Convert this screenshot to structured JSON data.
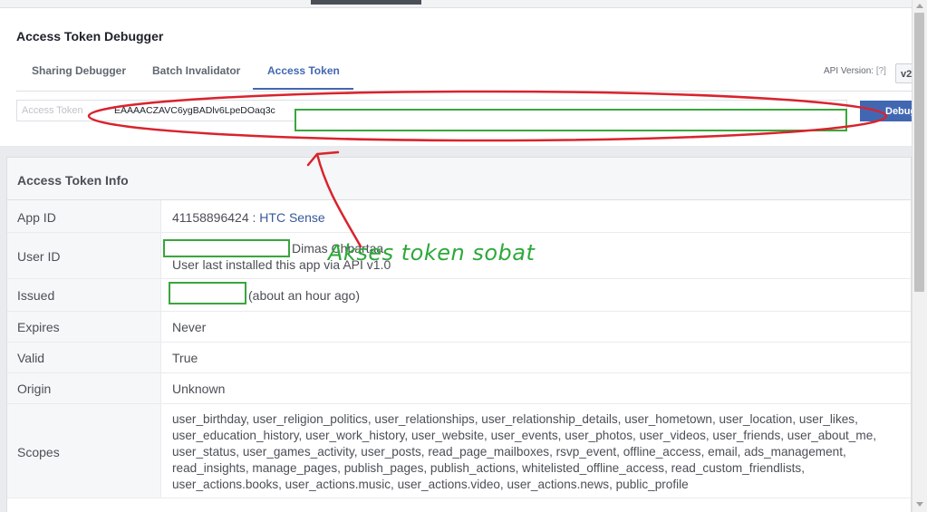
{
  "page": {
    "title": "Access Token Debugger"
  },
  "tabs": [
    {
      "label": "Sharing Debugger"
    },
    {
      "label": "Batch Invalidator"
    },
    {
      "label": "Access Token"
    }
  ],
  "api_version": {
    "label": "API Version:",
    "help": "[?]",
    "selected": "v2"
  },
  "token_input": {
    "placeholder": "Access Token",
    "value": "EAAAACZAVC6ygBADlv6LpeDOaq3c"
  },
  "debug_button": {
    "label": "Debug"
  },
  "info": {
    "title": "Access Token Info",
    "app_id": {
      "label": "App ID",
      "id": "41158896424",
      "separator": " : ",
      "app_name": "HTC Sense"
    },
    "user_id": {
      "label": "User ID",
      "name": "Dimas Chpartaa",
      "note": "User last installed this app via API v1.0"
    },
    "issued": {
      "label": "Issued",
      "value": "(about an hour ago)"
    },
    "expires": {
      "label": "Expires",
      "value": "Never"
    },
    "valid": {
      "label": "Valid",
      "value": "True"
    },
    "origin": {
      "label": "Origin",
      "value": "Unknown"
    },
    "scopes": {
      "label": "Scopes",
      "lines": [
        "user_birthday, user_religion_politics, user_relationships, user_relationship_details, user_hometown, user_location, user_likes,",
        "user_education_history, user_work_history, user_website, user_events, user_photos, user_videos, user_friends, user_about_me,",
        "user_status, user_games_activity, user_posts, read_page_mailboxes, rsvp_event, offline_access, email, ads_management,",
        "read_insights, manage_pages, publish_pages, publish_actions, whitelisted_offline_access, read_custom_friendlists,",
        "user_actions.books, user_actions.music, user_actions.video, user_actions.news, public_profile"
      ]
    }
  },
  "annotation": {
    "text": "Akses token sobat",
    "color": "#2ea83a",
    "ellipse_color": "#d9232d"
  },
  "colors": {
    "accent": "#4267b2",
    "link": "#365899",
    "redaction_border": "#3aa63c"
  }
}
